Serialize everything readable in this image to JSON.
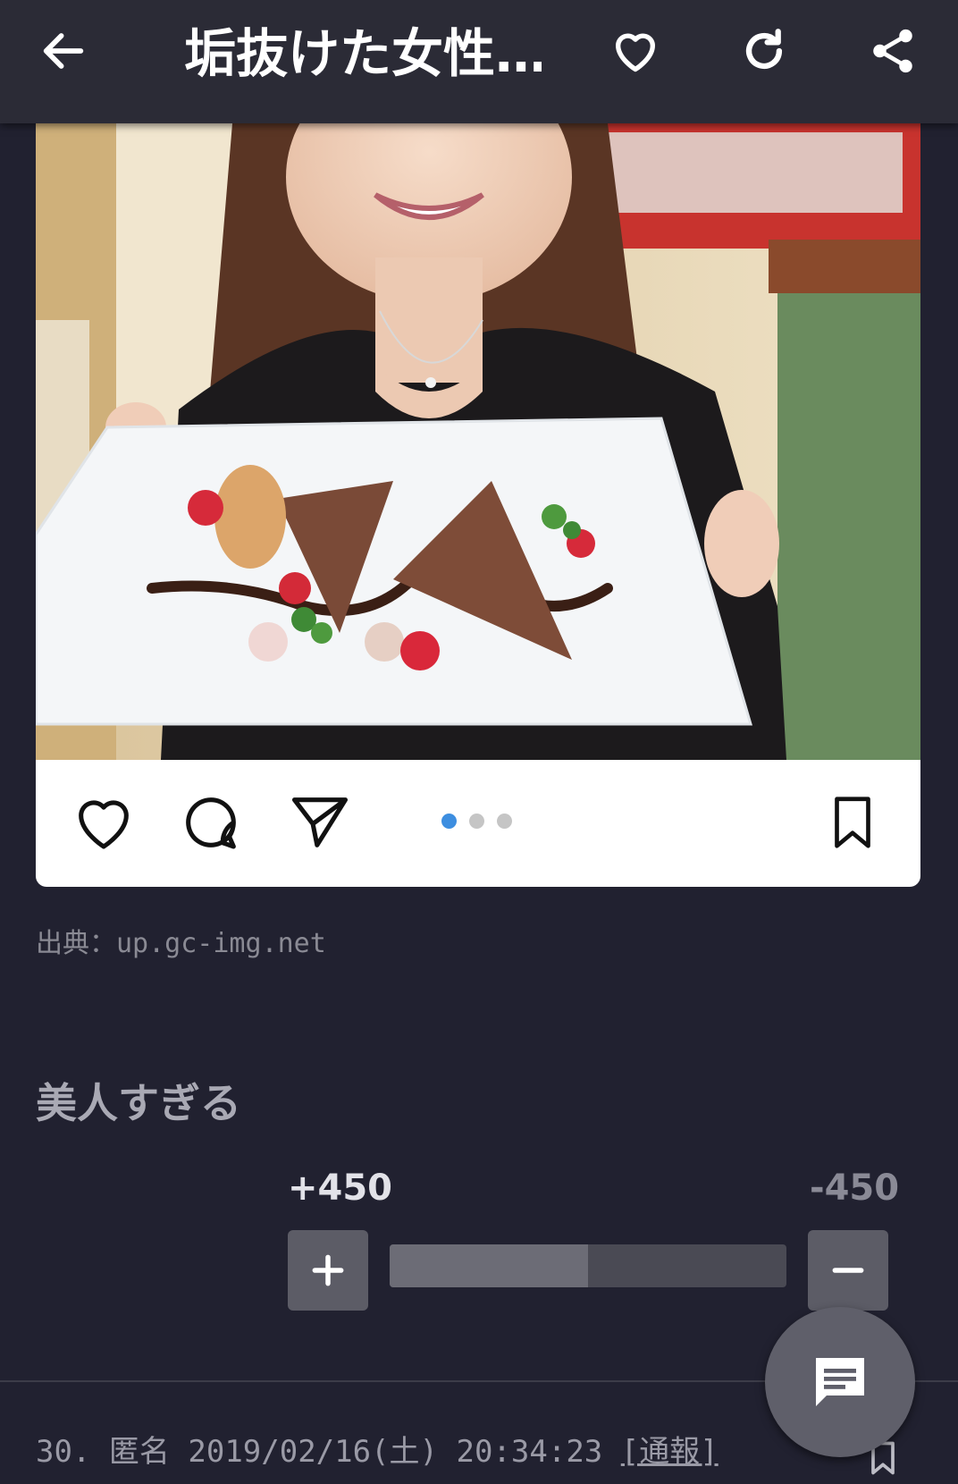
{
  "header": {
    "title": "垢抜けた女性…",
    "back_icon": "arrow-left-icon",
    "favorite_icon": "heart-icon",
    "refresh_icon": "refresh-icon",
    "share_icon": "share-icon"
  },
  "post": {
    "icons": [
      "heart-icon",
      "comment-icon",
      "send-icon",
      "bookmark-icon"
    ],
    "carousel": {
      "count": 3,
      "active_index": 0
    }
  },
  "source": {
    "text": "出典：up.gc-img.net"
  },
  "comment": {
    "text": "美人すぎる",
    "plus_count": "+450",
    "minus_count": "-450",
    "vote_ratio": 0.5
  },
  "next_comment": {
    "number": "30.",
    "author": "匿名",
    "datetime": "2019/02/16(土) 20:34:23",
    "report_label": "[通報]"
  },
  "colors": {
    "background": "#212130",
    "header": "#2b2b36",
    "accent_dot": "#3d8ee0"
  }
}
